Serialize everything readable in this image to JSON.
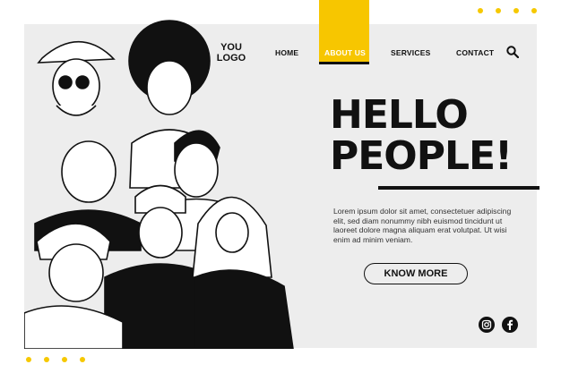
{
  "brand": {
    "logo_line1": "YOU",
    "logo_line2": "LOGO"
  },
  "nav": {
    "items": [
      {
        "label": "HOME"
      },
      {
        "label": "ABOUT US"
      },
      {
        "label": "SERVICES"
      },
      {
        "label": "CONTACT"
      }
    ],
    "active": "ABOUT US",
    "search_icon": "search-icon"
  },
  "hero": {
    "title_line1": "HELLO",
    "title_line2": "PEOPLE!",
    "body": "Lorem ipsum dolor sit amet, consectetuer adipiscing elit, sed diam nonummy nibh euismod tincidunt ut laoreet dolore magna aliquam erat volutpat. Ut wisi enim ad minim veniam.",
    "cta_label": "KNOW MORE"
  },
  "social": [
    "instagram-icon",
    "facebook-icon"
  ],
  "colors": {
    "accent": "#f7c600",
    "text": "#111111",
    "card": "#ededed"
  }
}
